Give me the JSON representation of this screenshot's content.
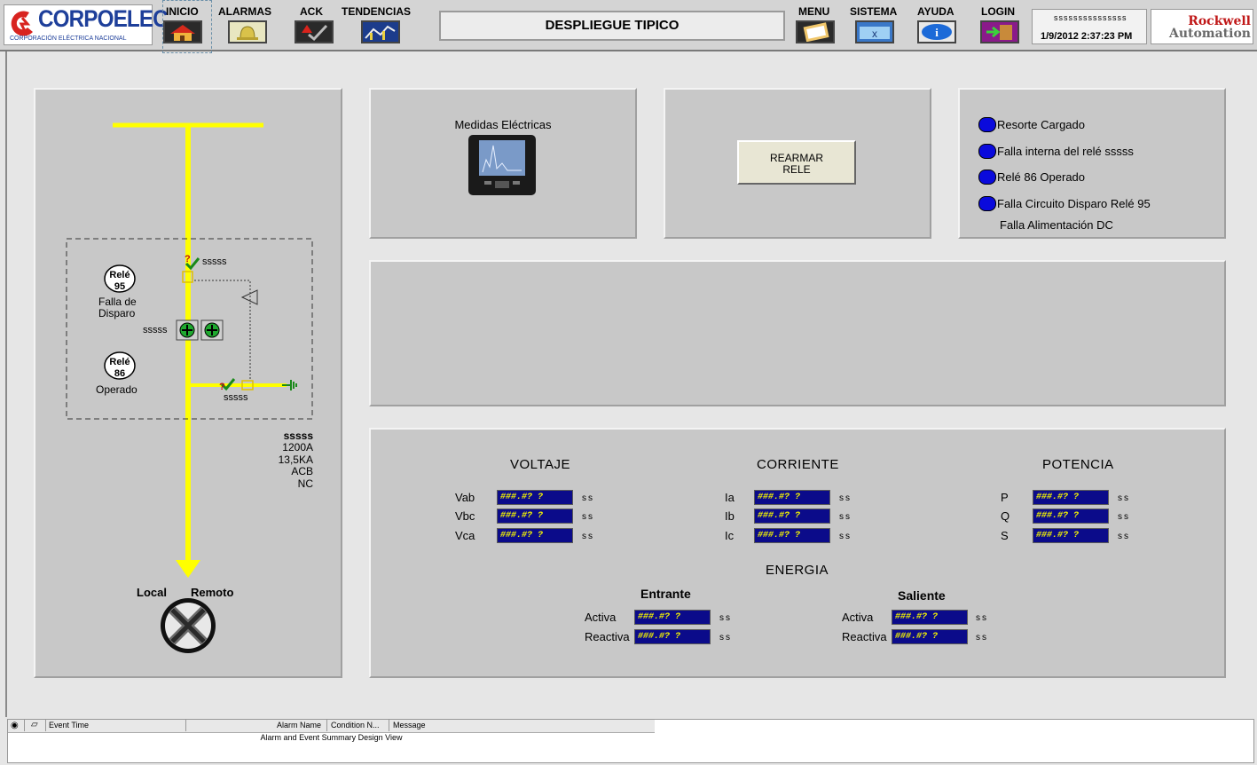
{
  "header": {
    "logo_text": "CORPOELEC",
    "logo_subtitle": "CORPORACIÓN ELÉCTRICA NACIONAL",
    "nav_left": [
      {
        "label": "INICIO",
        "icon": "home-icon"
      },
      {
        "label": "ALARMAS",
        "icon": "bell-icon"
      },
      {
        "label": "ACK",
        "icon": "ack-check-icon"
      },
      {
        "label": "TENDENCIAS",
        "icon": "trend-chart-icon"
      }
    ],
    "title": "DESPLIEGUE TIPICO",
    "nav_right": [
      {
        "label": "MENU",
        "icon": "clipboard-icon"
      },
      {
        "label": "SISTEMA",
        "icon": "folder-x-icon"
      },
      {
        "label": "AYUDA",
        "icon": "info-icon"
      },
      {
        "label": "LOGIN",
        "icon": "door-login-icon"
      }
    ],
    "user_id": "sssssssssssssss",
    "datetime": "1/9/2012 2:37:23 PM",
    "brand_line1": "Rockwell",
    "brand_line2": "Automation"
  },
  "diagram": {
    "relay95_label": "Relé",
    "relay95_num": "95",
    "relay95_caption1": "Falla de",
    "relay95_caption2": "Disparo",
    "relay86_label": "Relé",
    "relay86_num": "86",
    "relay86_caption": "Operado",
    "tag_top": "sssss",
    "tag_mid": "sssss",
    "tag_bottom": "sssss",
    "breaker_name": "sssss",
    "breaker_specs": [
      "1200A",
      "13,5KA",
      "ACB",
      "NC"
    ],
    "local_label": "Local",
    "remote_label": "Remoto"
  },
  "medidas": {
    "title": "Medidas Eléctricas"
  },
  "rearmar": {
    "line1": "REARMAR",
    "line2": "RELE"
  },
  "status": [
    "Resorte Cargado",
    "Falla interna del relé sssss",
    "Relé  86 Operado",
    "Falla Circuito Disparo Relé 95",
    "Falla Alimentación DC"
  ],
  "measurements": {
    "voltaje": {
      "title": "VOLTAJE",
      "rows": [
        {
          "label": "Vab",
          "value": "###.#? ?",
          "unit": "ss"
        },
        {
          "label": "Vbc",
          "value": "###.#? ?",
          "unit": "ss"
        },
        {
          "label": "Vca",
          "value": "###.#? ?",
          "unit": "ss"
        }
      ]
    },
    "corriente": {
      "title": "CORRIENTE",
      "rows": [
        {
          "label": "Ia",
          "value": "###.#? ?",
          "unit": "ss"
        },
        {
          "label": "Ib",
          "value": "###.#? ?",
          "unit": "ss"
        },
        {
          "label": "Ic",
          "value": "###.#? ?",
          "unit": "ss"
        }
      ]
    },
    "potencia": {
      "title": "POTENCIA",
      "rows": [
        {
          "label": "P",
          "value": "###.#? ?",
          "unit": "ss"
        },
        {
          "label": "Q",
          "value": "###.#? ?",
          "unit": "ss"
        },
        {
          "label": "S",
          "value": "###.#? ?",
          "unit": "ss"
        }
      ]
    },
    "energia": {
      "title": "ENERGIA",
      "entrante": {
        "title": "Entrante",
        "rows": [
          {
            "label": "Activa",
            "value": "###.#? ?",
            "unit": "ss"
          },
          {
            "label": "Reactiva",
            "value": "###.#? ?",
            "unit": "ss"
          }
        ]
      },
      "saliente": {
        "title": "Saliente",
        "rows": [
          {
            "label": "Activa",
            "value": "###.#? ?",
            "unit": "ss"
          },
          {
            "label": "Reactiva",
            "value": "###.#? ?",
            "unit": "ss"
          }
        ]
      }
    }
  },
  "event_bar": {
    "col_event_time": "Event Time",
    "col_alarm_name": "Alarm Name",
    "col_condition": "Condition N...",
    "col_message": "Message",
    "design_view": "Alarm and Event Summary Design View"
  },
  "colors": {
    "bus": "#ffff00",
    "value_bg": "#0b0b8a",
    "value_text": "#f5f500",
    "led": "#0a0adc"
  }
}
